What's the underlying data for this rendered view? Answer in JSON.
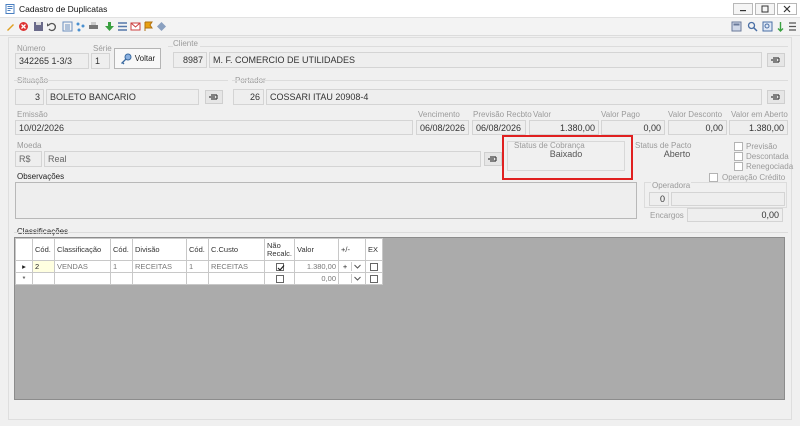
{
  "window": {
    "title": "Cadastro de Duplicatas"
  },
  "voltar_button": {
    "label": "Voltar"
  },
  "numero": {
    "label": "Número",
    "value": "342265 1-3/3"
  },
  "serie": {
    "label": "Série",
    "value": "1"
  },
  "cliente": {
    "label": "Cliente",
    "code": "8987",
    "name": "M. F. COMERCIO DE UTILIDADES"
  },
  "situacao": {
    "label": "Situação",
    "code": "3",
    "name": "BOLETO BANCARIO"
  },
  "portador": {
    "label": "Portador",
    "code": "26",
    "name": "COSSARI ITAU 20908-4"
  },
  "emissao": {
    "label": "Emissão",
    "value": "10/02/2026"
  },
  "vencimento": {
    "label": "Vencimento",
    "value": "06/08/2026"
  },
  "previsao_recbto": {
    "label": "Previsão Recbto",
    "value": "06/08/2026"
  },
  "valor": {
    "label": "Valor",
    "value": "1.380,00"
  },
  "valor_pago": {
    "label": "Valor Pago",
    "value": "0,00"
  },
  "valor_desconto": {
    "label": "Valor Desconto",
    "value": "0,00"
  },
  "valor_em_aberto": {
    "label": "Valor em Aberto",
    "value": "1.380,00"
  },
  "moeda": {
    "label": "Moeda",
    "code": "R$",
    "name": "Real"
  },
  "status_cobranca": {
    "label": "Status de Cobrança",
    "value": "Baixado"
  },
  "status_pacto": {
    "label": "Status de Pacto",
    "value": "Aberto"
  },
  "flags": {
    "previsao": "Previsão",
    "descontada": "Descontada",
    "renegociada": "Renegociada",
    "operacao_credito": "Operação Crédito"
  },
  "observacoes": {
    "label": "Observações"
  },
  "operadora": {
    "label": "Operadora",
    "code": "0",
    "name": ""
  },
  "encargos": {
    "label": "Encargos",
    "value": "0,00"
  },
  "classificacoes": {
    "label": "Classificações",
    "columns": [
      "Cód.",
      "Classificação",
      "Cód.",
      "Divisão",
      "Cód.",
      "C.Custo",
      "Não Recalc.",
      "Valor",
      "+/-",
      "EX"
    ],
    "rows": [
      {
        "cod": "2",
        "classificacao": "VENDAS",
        "cod_div": "1",
        "divisao": "RECEITAS",
        "cod_cc": "1",
        "ccusto": "RECEITAS",
        "nao_recalc": true,
        "valor": "1.380,00",
        "sinal": "+",
        "ex": false
      },
      {
        "cod": "",
        "classificacao": "",
        "cod_div": "",
        "divisao": "",
        "cod_cc": "",
        "ccusto": "",
        "nao_recalc": false,
        "valor": "0,00",
        "sinal": "",
        "ex": false
      }
    ]
  },
  "colors": {
    "highlight_border": "#e02020",
    "grid_bg": "#ababab",
    "field_bg": "#eeeeee"
  }
}
